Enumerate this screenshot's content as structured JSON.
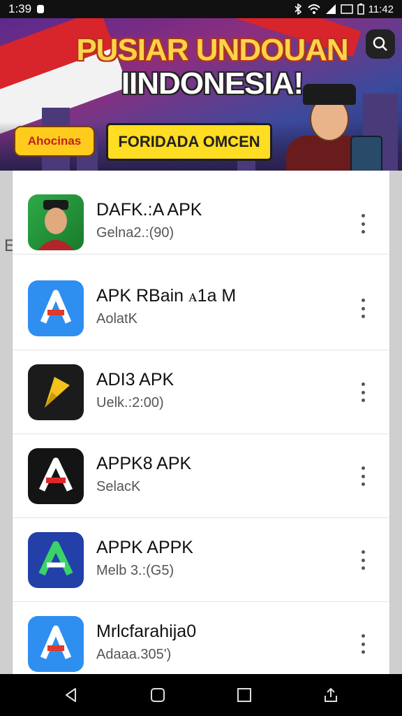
{
  "status_bar": {
    "time": "1:39",
    "right_text": "11:42"
  },
  "banner": {
    "title_line1": "PUSIAR UNDOUAN",
    "title_line2": "IINDONESIA!",
    "left_pill": "Ahocinas",
    "main_pill": "FORIDADA OMCEN"
  },
  "apps": [
    {
      "name": "DAFK.:A APK",
      "subtitle": "Gelna2.:(90)",
      "icon": "person-avatar-icon"
    },
    {
      "name": "APK RBain ꭺ1a M",
      "subtitle": "AolatK",
      "icon": "blue-a-logo-icon"
    },
    {
      "name": "ADI3 APK",
      "subtitle": "Uelk.:2:00)",
      "icon": "yellow-p-logo-icon"
    },
    {
      "name": "APPK8 APK",
      "subtitle": "SelacK",
      "icon": "black-a-logo-icon"
    },
    {
      "name": "APPK APPK",
      "subtitle": "Melb 3.:(G5)",
      "icon": "green-a-logo-icon"
    },
    {
      "name": "Mrlcfarahija0",
      "subtitle": "Adaaa.305')",
      "icon": "blue-a-logo-icon"
    }
  ],
  "background": {
    "left_letter": "E"
  },
  "colors": {
    "accent_yellow": "#ffdd22",
    "banner_red": "#d8242b"
  }
}
